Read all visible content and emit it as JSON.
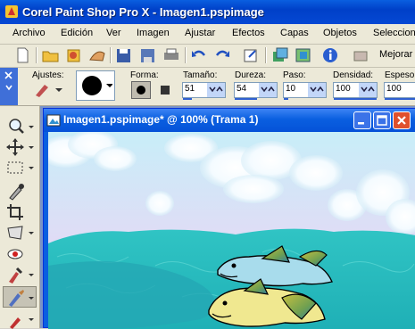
{
  "window": {
    "title": "Corel Paint Shop Pro X - Imagen1.pspimage"
  },
  "menu": [
    {
      "label": "Archivo"
    },
    {
      "label": "Edición"
    },
    {
      "label": "Ver"
    },
    {
      "label": "Imagen"
    },
    {
      "label": "Ajustar"
    },
    {
      "label": "Efectos"
    },
    {
      "label": "Capas"
    },
    {
      "label": "Objetos"
    },
    {
      "label": "Seleccione"
    }
  ],
  "toolbar": {
    "mejorar_label": "Mejorar f"
  },
  "tool_options": {
    "ajustes_label": "Ajustes:",
    "forma_label": "Forma:",
    "tamano": {
      "label": "Tamaño:",
      "value": "51"
    },
    "dureza": {
      "label": "Dureza:",
      "value": "54"
    },
    "paso": {
      "label": "Paso:",
      "value": "10"
    },
    "densidad": {
      "label": "Densidad:",
      "value": "100"
    },
    "espesor": {
      "label": "Espesor:",
      "value": "100"
    }
  },
  "image_window": {
    "title": "Imagen1.pspimage* @ 100% (Trama 1)"
  },
  "colors": {
    "xp_blue": "#0a5fe0",
    "sea": "#2fc1c0",
    "sky_top": "#c8eef8",
    "sky_bottom": "#e8c8f0"
  }
}
